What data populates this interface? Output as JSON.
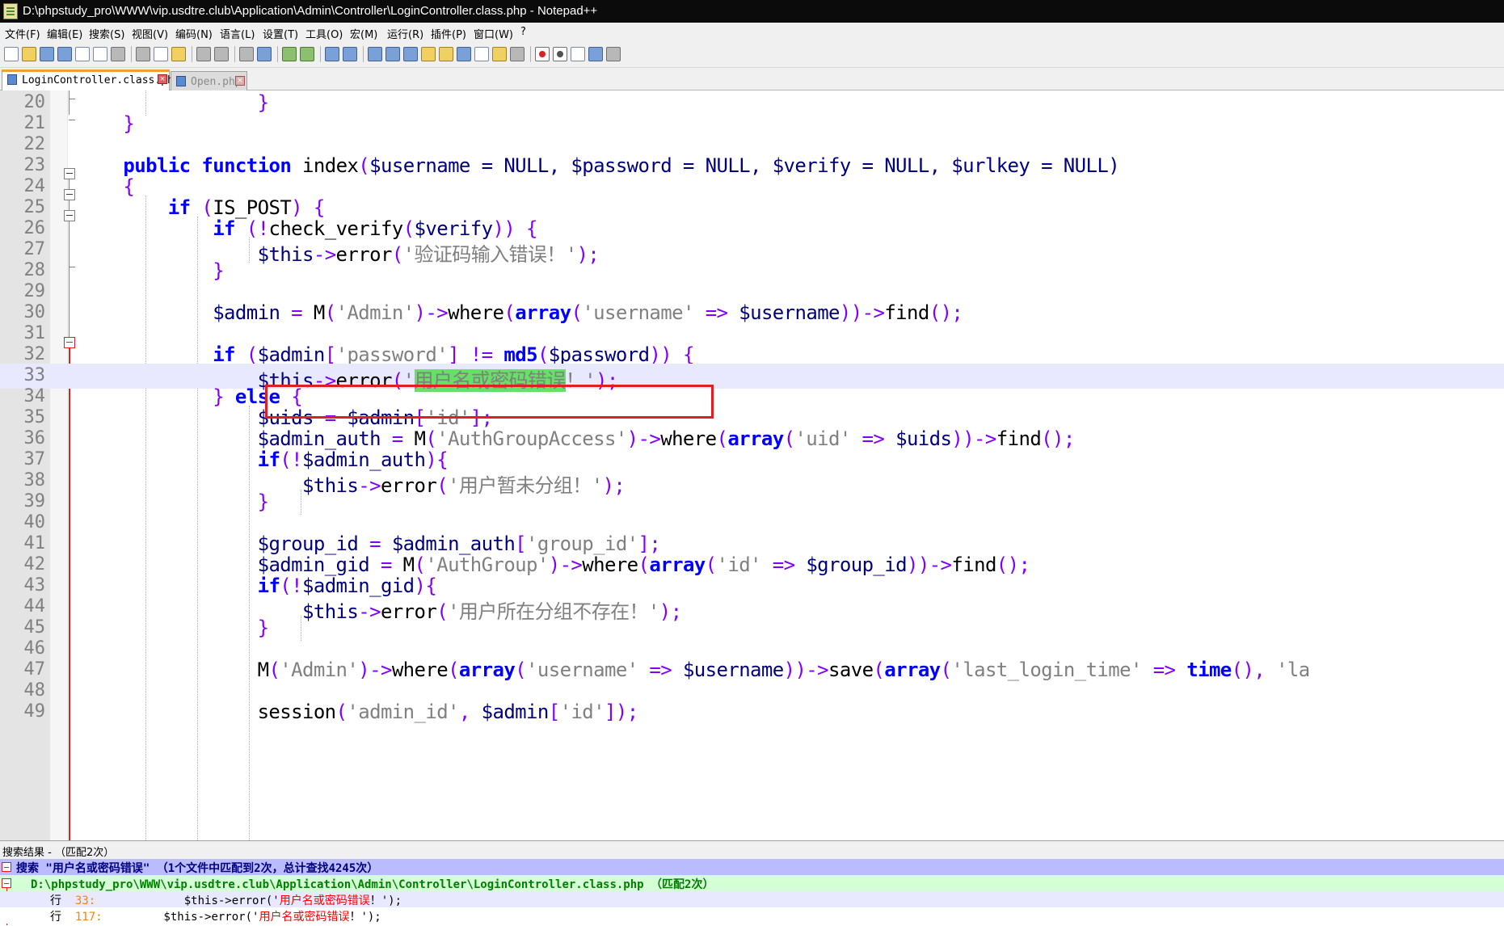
{
  "window": {
    "title": "D:\\phpstudy_pro\\WWW\\vip.usdtre.club\\Application\\Admin\\Controller\\LoginController.class.php - Notepad++"
  },
  "menu": [
    "文件(F)",
    "编辑(E)",
    "搜索(S)",
    "视图(V)",
    "编码(N)",
    "语言(L)",
    "设置(T)",
    "工具(O)",
    "宏(M)",
    "运行(R)",
    "插件(P)",
    "窗口(W)",
    "?"
  ],
  "tabs": [
    {
      "label": "LoginController.class.php",
      "active": true
    },
    {
      "label": "Open.php",
      "active": false
    }
  ],
  "editor": {
    "line_numbers": [
      "20",
      "21",
      "22",
      "23",
      "24",
      "25",
      "26",
      "27",
      "28",
      "29",
      "30",
      "31",
      "32",
      "33",
      "34",
      "35",
      "36",
      "37",
      "38",
      "39",
      "40",
      "41",
      "42",
      "43",
      "44",
      "45",
      "46",
      "47",
      "48",
      "49"
    ],
    "current_line": "33",
    "highlight_color": "#66e066",
    "box_color": "#e02020"
  },
  "code": {
    "l20": "}",
    "l21": "}",
    "l23_public": "public",
    "l23_function": "function",
    "l23_name": "index",
    "l23_args": "$username = NULL, $password = NULL, $verify = NULL, $urlkey = NULL)",
    "l27_str": "'验证码输入错误！'",
    "l30_str1": "'Admin'",
    "l30_str2": "'username'",
    "l32_str": "'password'",
    "l33_match": "用户名或密码错误",
    "l36_str1": "'AuthGroupAccess'",
    "l36_str2": "'uid'",
    "l38_str": "'用户暂未分组！'",
    "l41_str": "'group_id'",
    "l42_str1": "'AuthGroup'",
    "l42_str2": "'id'",
    "l44_str": "'用户所在分组不存在！'",
    "l47_str1": "'Admin'",
    "l47_str2": "'username'",
    "l47_str3": "'last_login_time'",
    "l49_str1": "'admin_id'",
    "l49_str2": "'id'"
  },
  "results": {
    "title": "搜索结果 - （匹配2次）",
    "search_line": "搜索 \"用户名或密码错误\" （1个文件中匹配到2次，总计查找4245次）",
    "file_line": "D:\\phpstudy_pro\\WWW\\vip.usdtre.club\\Application\\Admin\\Controller\\LoginController.class.php （匹配2次）",
    "hits": [
      {
        "label": "行",
        "num": "33:",
        "code_before": "             $this->error('",
        "match": "用户名或密码错误",
        "code_after": "！');"
      },
      {
        "label": "行",
        "num": "117:",
        "code_before": "         $this->error('",
        "match": "用户名或密码错误",
        "code_after": "！');"
      }
    ]
  }
}
